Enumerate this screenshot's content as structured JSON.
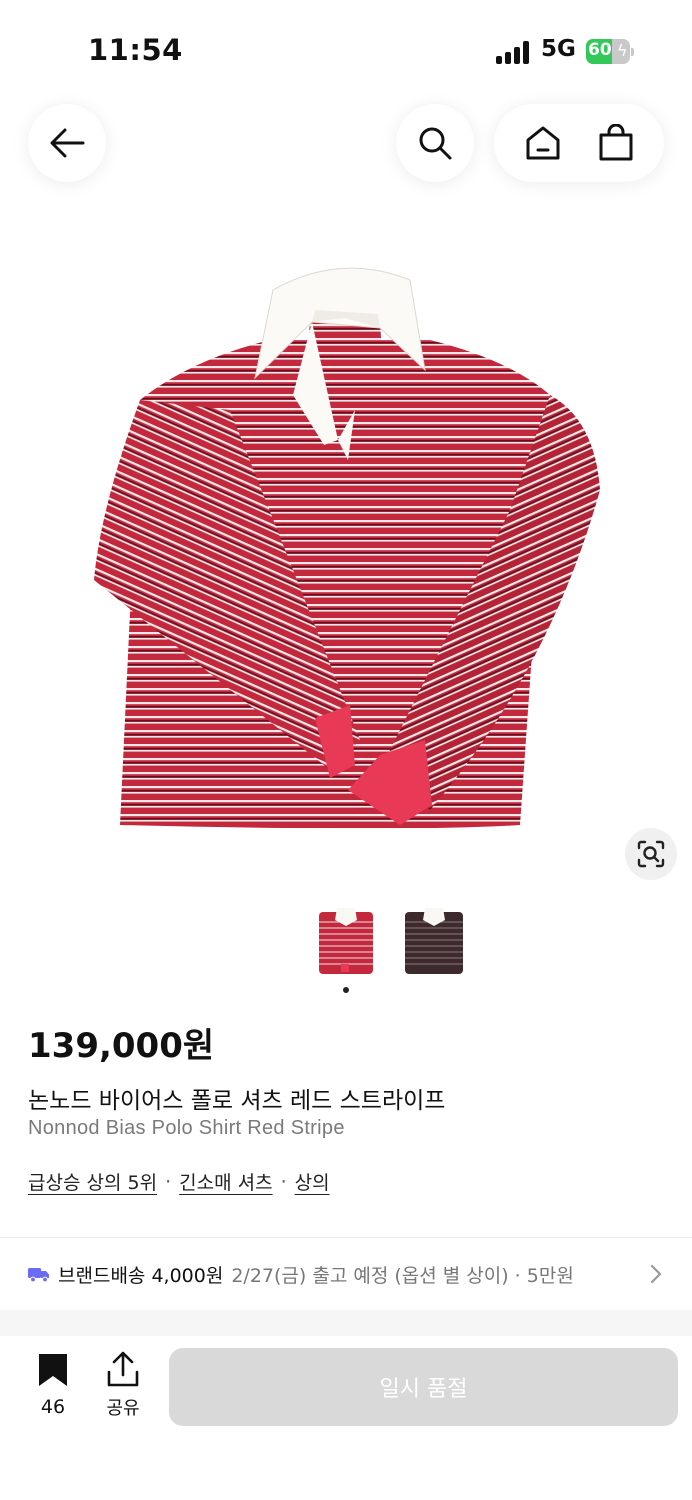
{
  "status_bar": {
    "time": "11:54",
    "network": "5G",
    "battery_level": "60",
    "battery_fraction": 0.6,
    "signal_bars": 4,
    "icons": [
      "signal-icon",
      "battery-charging-icon"
    ]
  },
  "nav": {
    "icons": [
      "arrow-left-icon",
      "search-icon",
      "home-icon",
      "shopping-bag-icon"
    ]
  },
  "gallery": {
    "image_count": 2,
    "active_index": 0,
    "thumbnails": [
      "red-stripe-polo-thumbnail",
      "dark-stripe-polo-thumbnail"
    ],
    "lens_icon": "visual-search-icon"
  },
  "product": {
    "price": "139,000원",
    "name_ko": "논노드 바이어스 폴로 셔츠 레드 스트라이프",
    "name_en": "Nonnod Bias Polo Shirt Red Stripe",
    "tags": [
      "급상승 상의 5위",
      "긴소매 셔츠",
      "상의"
    ],
    "tag_separator": "·"
  },
  "delivery": {
    "icon": "truck-icon",
    "label": "브랜드배송 4,000원",
    "detail": "2/27(금) 출고 예정 (옵션 별 상이) · 5만원"
  },
  "bottom_bar": {
    "bookmark_count": "46",
    "share_label": "공유",
    "sold_out_label": "일시 품절"
  },
  "colors": {
    "shirt_red": "#c4283d",
    "truck_purple": "#6b6bf5",
    "battery_green": "#34c759",
    "button_disabled": "#d9d9d9"
  }
}
